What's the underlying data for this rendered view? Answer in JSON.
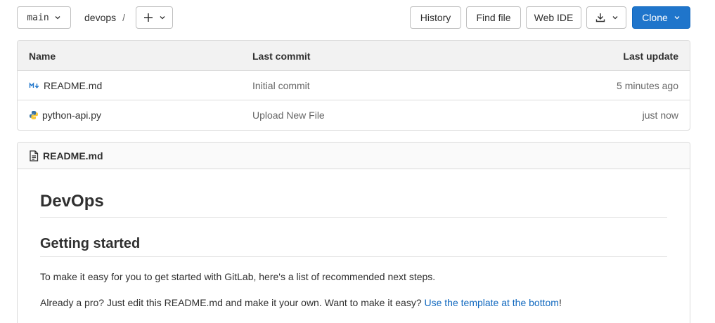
{
  "toolbar": {
    "branch": "main",
    "breadcrumb_project": "devops",
    "breadcrumb_sep": "/",
    "add_icon": "plus-icon",
    "history_label": "History",
    "find_file_label": "Find file",
    "web_ide_label": "Web IDE",
    "download_icon": "download-icon",
    "clone_label": "Clone"
  },
  "file_tree": {
    "headers": {
      "name": "Name",
      "last_commit": "Last commit",
      "last_update": "Last update"
    },
    "rows": [
      {
        "icon": "markdown-icon",
        "name": "README.md",
        "commit": "Initial commit",
        "updated": "5 minutes ago"
      },
      {
        "icon": "python-icon",
        "name": "python-api.py",
        "commit": "Upload New File",
        "updated": "just now"
      }
    ]
  },
  "readme": {
    "header_icon": "file-icon",
    "header_title": "README.md",
    "h1": "DevOps",
    "h2": "Getting started",
    "p1": "To make it easy for you to get started with GitLab, here's a list of recommended next steps.",
    "p2_text": "Already a pro? Just edit this README.md and make it your own. Want to make it easy? ",
    "p2_link": "Use the template at the bottom",
    "p2_end": "!"
  },
  "colors": {
    "primary": "#1f75cb",
    "link": "#1068bf",
    "border": "#dbdbdb"
  }
}
